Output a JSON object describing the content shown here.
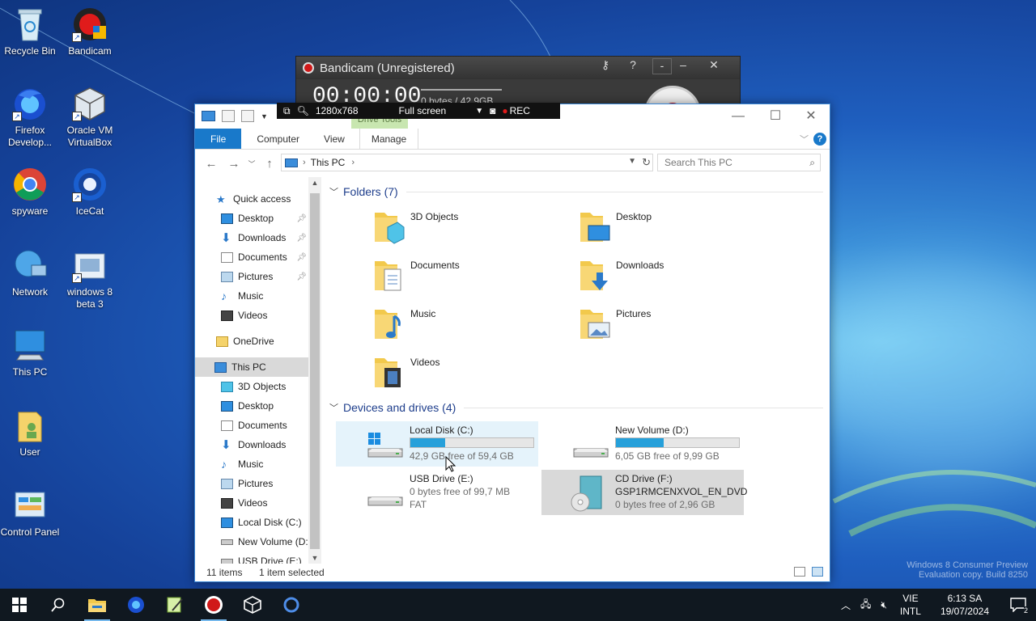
{
  "desktop": {
    "icons": [
      {
        "label": "Recycle Bin"
      },
      {
        "label": "Bandicam"
      },
      {
        "label": "Firefox Develop..."
      },
      {
        "label": "Oracle VM VirtualBox"
      },
      {
        "label": "spyware"
      },
      {
        "label": "IceCat"
      },
      {
        "label": "Network"
      },
      {
        "label": "windows 8 beta 3"
      },
      {
        "label": "This PC"
      },
      {
        "label": "User"
      },
      {
        "label": "Control Panel"
      }
    ]
  },
  "bandicam": {
    "title": "Bandicam (Unregistered)",
    "timer": "00:00:00",
    "size_readout": "0 bytes / 42.9GB",
    "toolbar": {
      "resolution": "1280x768",
      "mode": "Full screen",
      "rec": "REC"
    }
  },
  "explorer": {
    "ribbon": {
      "context_group": "Drive Tools",
      "tabs": [
        "File",
        "Computer",
        "View",
        "Manage"
      ]
    },
    "address": {
      "location": "This PC"
    },
    "search": {
      "placeholder": "Search This PC"
    },
    "nav": [
      {
        "label": "Quick access",
        "pinned": false
      },
      {
        "label": "Desktop",
        "pinned": true
      },
      {
        "label": "Downloads",
        "pinned": true
      },
      {
        "label": "Documents",
        "pinned": true
      },
      {
        "label": "Pictures",
        "pinned": true
      },
      {
        "label": "Music",
        "pinned": false
      },
      {
        "label": "Videos",
        "pinned": false
      },
      {
        "label": "OneDrive",
        "pinned": false
      },
      {
        "label": "This PC",
        "pinned": false,
        "selected": true
      },
      {
        "label": "3D Objects",
        "pinned": false
      },
      {
        "label": "Desktop",
        "pinned": false
      },
      {
        "label": "Documents",
        "pinned": false
      },
      {
        "label": "Downloads",
        "pinned": false
      },
      {
        "label": "Music",
        "pinned": false
      },
      {
        "label": "Pictures",
        "pinned": false
      },
      {
        "label": "Videos",
        "pinned": false
      },
      {
        "label": "Local Disk (C:)",
        "pinned": false
      },
      {
        "label": "New Volume (D:)",
        "pinned": false
      },
      {
        "label": "USB Drive (E:)",
        "pinned": false
      }
    ],
    "folders_header": "Folders (7)",
    "folders": [
      "3D Objects",
      "Desktop",
      "Documents",
      "Downloads",
      "Music",
      "Pictures",
      "Videos"
    ],
    "drives_header": "Devices and drives (4)",
    "drives": [
      {
        "name": "Local Disk (C:)",
        "free": "42,9 GB free of 59,4 GB",
        "used_fraction": 0.28,
        "state": "hover"
      },
      {
        "name": "New Volume (D:)",
        "free": "6,05 GB free of 9,99 GB",
        "used_fraction": 0.39,
        "state": ""
      },
      {
        "name": "USB Drive (E:)",
        "free": "0 bytes free of 99,7 MB",
        "extra": "FAT",
        "state": ""
      },
      {
        "name": "CD Drive (F:)",
        "label2": "GSP1RMCENXVOL_EN_DVD",
        "free": "0 bytes free of 2,96 GB",
        "state": "selected"
      }
    ],
    "status": {
      "items": "11 items",
      "selected": "1 item selected"
    }
  },
  "taskbar": {
    "lang_top": "VIE",
    "lang_bottom": "INTL",
    "time": "6:13 SA",
    "date": "19/07/2024",
    "notifications": "2"
  },
  "watermark": {
    "line1": "Windows 8 Consumer Preview",
    "line2": "Evaluation copy. Build 8250"
  }
}
